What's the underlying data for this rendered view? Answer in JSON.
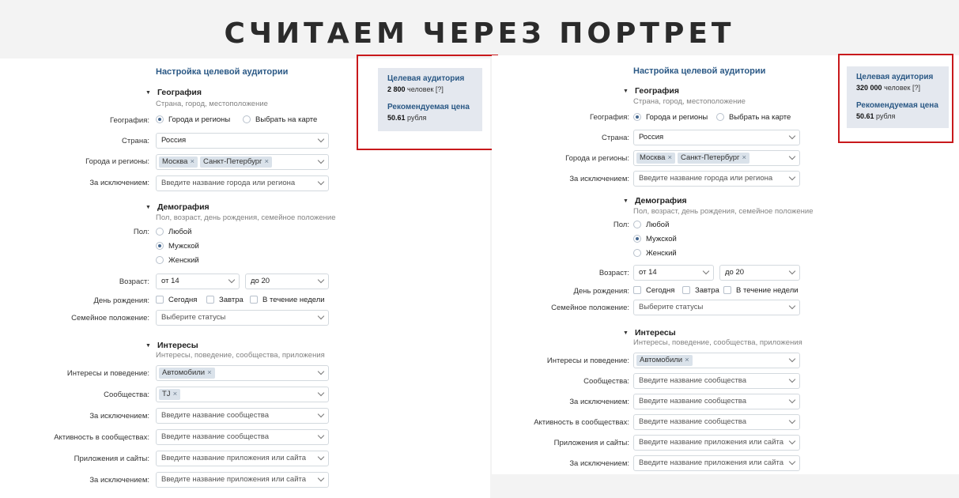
{
  "slide": {
    "title": "СЧИТАЕМ ЧЕРЕЗ ПОРТРЕТ"
  },
  "left": {
    "heading": "Настройка целевой аудитории",
    "geo": {
      "title": "География",
      "subtitle": "Страна, город, местоположение",
      "label_geo": "География:",
      "opt_cities": "Города и регионы",
      "opt_map": "Выбрать на карте",
      "label_country": "Страна:",
      "country": "Россия",
      "label_cities": "Города и регионы:",
      "cities": [
        "Москва",
        "Санкт-Петербург"
      ],
      "label_except": "За исключением:",
      "except_placeholder": "Введите название города или региона"
    },
    "demo": {
      "title": "Демография",
      "subtitle": "Пол, возраст, день рождения, семейное положение",
      "label_sex": "Пол:",
      "sex_any": "Любой",
      "sex_male": "Мужской",
      "sex_female": "Женский",
      "label_age": "Возраст:",
      "age_from": "от 14",
      "age_to": "до 20",
      "label_bday": "День рождения:",
      "bday_today": "Сегодня",
      "bday_tomorrow": "Завтра",
      "bday_week": "В течение недели",
      "label_family": "Семейное положение:",
      "family_placeholder": "Выберите статусы"
    },
    "interests": {
      "title": "Интересы",
      "subtitle": "Интересы, поведение, сообщества, приложения",
      "label_interests": "Интересы и поведение:",
      "interests_tag": "Автомобили",
      "label_communities": "Сообщества:",
      "communities_tag": "TJ",
      "label_except": "За исключением:",
      "community_placeholder": "Введите название сообщества",
      "label_activity": "Активность в сообществах:",
      "label_apps": "Приложения и сайты:",
      "apps_placeholder": "Введите название приложения или сайта",
      "label_except2": "За исключением:"
    },
    "audience": {
      "title": "Целевая аудитория",
      "count": "2 800",
      "count_suffix": "человек [?]",
      "price_title": "Рекомендуемая цена",
      "price": "50.61",
      "price_suffix": "рубля"
    }
  },
  "right": {
    "heading": "Настройка целевой аудитории",
    "geo": {
      "title": "География",
      "subtitle": "Страна, город, местоположение",
      "label_geo": "География:",
      "opt_cities": "Города и регионы",
      "opt_map": "Выбрать на карте",
      "label_country": "Страна:",
      "country": "Россия",
      "label_cities": "Города и регионы:",
      "cities": [
        "Москва",
        "Санкт-Петербург"
      ],
      "label_except": "За исключением:",
      "except_placeholder": "Введите название города или региона"
    },
    "demo": {
      "title": "Демография",
      "subtitle": "Пол, возраст, день рождения, семейное положение",
      "label_sex": "Пол:",
      "sex_any": "Любой",
      "sex_male": "Мужской",
      "sex_female": "Женский",
      "label_age": "Возраст:",
      "age_from": "от 14",
      "age_to": "до 20",
      "label_bday": "День рождения:",
      "bday_today": "Сегодня",
      "bday_tomorrow": "Завтра",
      "bday_week": "В течение недели",
      "label_family": "Семейное положение:",
      "family_placeholder": "Выберите статусы"
    },
    "interests": {
      "title": "Интересы",
      "subtitle": "Интересы, поведение, сообщества, приложения",
      "label_interests": "Интересы и поведение:",
      "interests_tag": "Автомобили",
      "label_communities": "Сообщества:",
      "community_placeholder": "Введите название сообщества",
      "label_except": "За исключением:",
      "label_activity": "Активность в сообществах:",
      "label_apps": "Приложения и сайты:",
      "apps_placeholder": "Введите название приложения или сайта",
      "label_except2": "За исключением:"
    },
    "audience": {
      "title": "Целевая аудитория",
      "count": "320 000",
      "count_suffix": "человек [?]",
      "price_title": "Рекомендуемая цена",
      "price": "50.61",
      "price_suffix": "рубля"
    }
  },
  "colors": {
    "highlight_frame": "#c8191c",
    "link": "#2a5885",
    "card_bg": "#e4e8ef",
    "tag_bg": "#dae2ea"
  }
}
